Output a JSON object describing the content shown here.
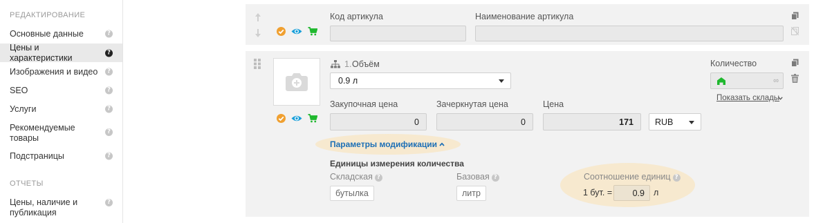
{
  "sidebar": {
    "section_editing": "РЕДАКТИРОВАНИЕ",
    "items": [
      {
        "label": "Основные данные"
      },
      {
        "label": "Цены и характеристики"
      },
      {
        "label": "Изображения и видео"
      },
      {
        "label": "SEO"
      },
      {
        "label": "Услуги"
      },
      {
        "label": "Рекомендуемые товары"
      },
      {
        "label": "Подстраницы"
      }
    ],
    "active_item": "Цены и характеристики",
    "section_reports": "ОТЧЕТЫ",
    "report_items": [
      {
        "label": "Цены, наличие и публикация"
      }
    ],
    "help_glyph": "?"
  },
  "panel_top": {
    "sku_code_label": "Код артикула",
    "sku_name_label": "Наименование артикула",
    "sku_code_value": "",
    "sku_name_value": ""
  },
  "variant": {
    "feature_number": "1.",
    "feature_name": "Объём",
    "feature_value": "0.9 л",
    "purchase_price_label": "Закупочная цена",
    "purchase_price_value": "0",
    "crossed_price_label": "Зачеркнутая цена",
    "crossed_price_value": "0",
    "price_label": "Цена",
    "price_value": "171",
    "currency": "RUB",
    "quantity_label": "Количество",
    "quantity_value": "∞",
    "show_stocks": "Показать склады",
    "mod_params_link": "Параметры модификации",
    "units_title": "Единицы измерения количества",
    "stock_unit_label": "Складская",
    "stock_unit_value": "бутылка",
    "base_unit_label": "Базовая",
    "base_unit_value": "литр",
    "ratio_label": "Соотношение единиц",
    "ratio_prefix": "1 бут. =",
    "ratio_value": "0.9",
    "ratio_suffix": "л"
  },
  "colors": {
    "accent_orange": "#f0a030",
    "eye_blue": "#1a9fd9",
    "cart_green": "#1fb82e",
    "link_blue": "#1c6fb6",
    "highlight": "#f7e9cf"
  }
}
